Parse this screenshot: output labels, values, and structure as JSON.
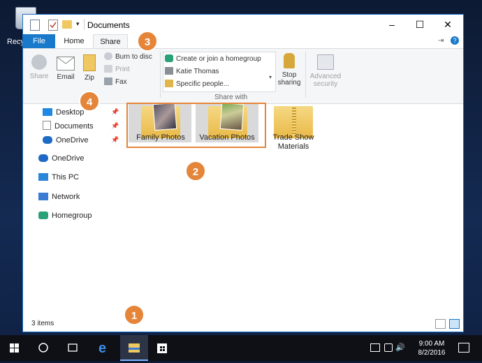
{
  "desktop": {
    "recycle_bin_label": "Recy"
  },
  "window": {
    "title": "Documents",
    "controls": {
      "minimize": "–",
      "maximize": "☐",
      "close": "✕"
    }
  },
  "tabs": {
    "file": "File",
    "home": "Home",
    "share": "Share"
  },
  "ribbon": {
    "share": "Share",
    "email": "Email",
    "zip": "Zip",
    "burn": "Burn to disc",
    "print": "Print",
    "fax": "Fax",
    "create_homegroup": "Create or join a homegroup",
    "katie": "Katie Thomas",
    "specific": "Specific people...",
    "share_with": "Share with",
    "stop_sharing": "Stop sharing",
    "advanced_security": "Advanced security"
  },
  "nav": {
    "desktop": "Desktop",
    "documents": "Documents",
    "onedrive_quick": "OneDrive",
    "onedrive": "OneDrive",
    "this_pc": "This PC",
    "network": "Network",
    "homegroup": "Homegroup"
  },
  "folders": {
    "family": "Family Photos",
    "vacation": "Vacation Photos",
    "trade_line1": "Trade Show",
    "trade_line2": "Materials"
  },
  "status": {
    "items": "3 items"
  },
  "callouts": {
    "c1": "1",
    "c2": "2",
    "c3": "3",
    "c4": "4"
  },
  "clock": {
    "time": "9:00 AM",
    "date": "8/2/2016"
  },
  "colors": {
    "accent": "#1979ca",
    "callout": "#e5853a",
    "folder": "#f0c862"
  }
}
